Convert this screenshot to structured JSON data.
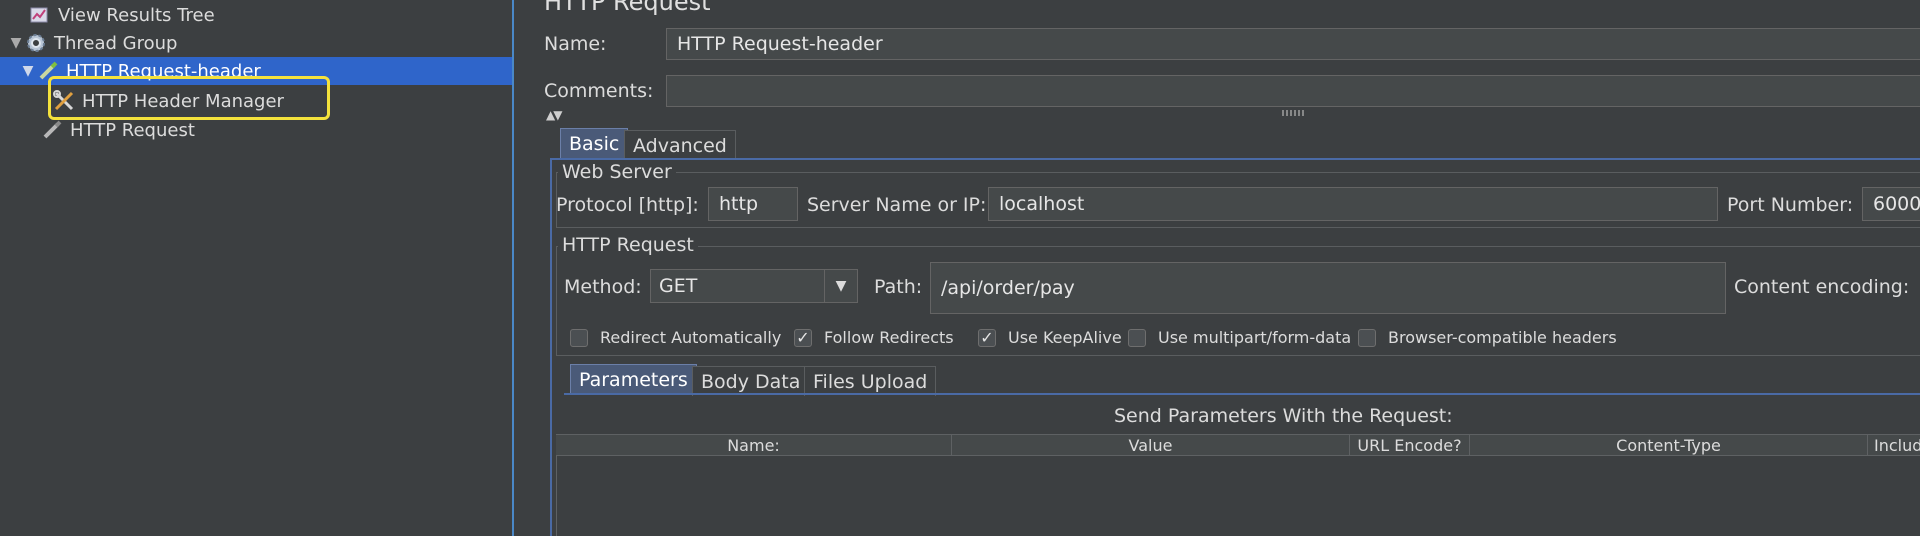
{
  "tree": {
    "items": [
      {
        "label": "View Results Tree",
        "icon": "chart-icon"
      },
      {
        "label": "Thread Group",
        "icon": "gear-icon"
      },
      {
        "label": "HTTP Request-header",
        "icon": "pen-icon"
      },
      {
        "label": "HTTP Header Manager",
        "icon": "wrench-screwdriver-icon"
      },
      {
        "label": "HTTP Request",
        "icon": "pen-icon"
      }
    ]
  },
  "panel": {
    "title": "HTTP Request",
    "name_label": "Name:",
    "name_value": "HTTP Request-header",
    "comments_label": "Comments:",
    "comments_value": ""
  },
  "tabs": {
    "basic": "Basic",
    "advanced": "Advanced"
  },
  "web_server": {
    "title": "Web Server",
    "protocol_label": "Protocol [http]:",
    "protocol_value": "http",
    "server_label": "Server Name or IP:",
    "server_value": "localhost",
    "port_label": "Port Number:",
    "port_value": "6000"
  },
  "http_request": {
    "title": "HTTP Request",
    "method_label": "Method:",
    "method_value": "GET",
    "path_label": "Path:",
    "path_value": "/api/order/pay",
    "encoding_label": "Content encoding:"
  },
  "options": {
    "redirect_auto": {
      "label": "Redirect Automatically",
      "checked": false
    },
    "follow_redirects": {
      "label": "Follow Redirects",
      "checked": true
    },
    "keepalive": {
      "label": "Use KeepAlive",
      "checked": true
    },
    "multipart": {
      "label": "Use multipart/form-data",
      "checked": false
    },
    "browser_headers": {
      "label": "Browser-compatible headers",
      "checked": false
    },
    "check_glyph": "✓"
  },
  "subtabs": {
    "parameters": "Parameters",
    "body_data": "Body Data",
    "files_upload": "Files Upload"
  },
  "params_table": {
    "caption": "Send Parameters With the Request:",
    "columns": [
      "Name:",
      "Value",
      "URL Encode?",
      "Content-Type",
      "Includ"
    ]
  },
  "colors": {
    "selection": "#2f65ca",
    "highlight": "#f4e23c",
    "accent": "#4a88c7"
  }
}
